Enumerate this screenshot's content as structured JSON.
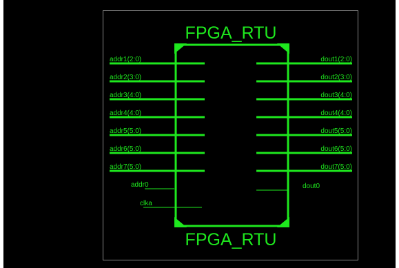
{
  "component": {
    "title_top": "FPGA_RTU",
    "title_bottom": "FPGA_RTU"
  },
  "left_pins": [
    {
      "label": "addr1(2:0)"
    },
    {
      "label": "addr2(3:0)"
    },
    {
      "label": "addr3(4:0)"
    },
    {
      "label": "addr4(4:0)"
    },
    {
      "label": "addr5(5:0)"
    },
    {
      "label": "addr6(5:0)"
    },
    {
      "label": "addr7(5:0)"
    },
    {
      "label": "addr0"
    },
    {
      "label": "clka"
    }
  ],
  "right_pins": [
    {
      "label": "dout1(2:0)"
    },
    {
      "label": "dout2(3:0)"
    },
    {
      "label": "dout3(4:0)"
    },
    {
      "label": "dout4(4:0)"
    },
    {
      "label": "dout5(5:0)"
    },
    {
      "label": "dout6(5:0)"
    },
    {
      "label": "dout7(5:0)"
    },
    {
      "label": "dout0"
    }
  ],
  "colors": {
    "wire": "#1ee81e",
    "background": "#000000",
    "frame": "#8a8a8a"
  }
}
